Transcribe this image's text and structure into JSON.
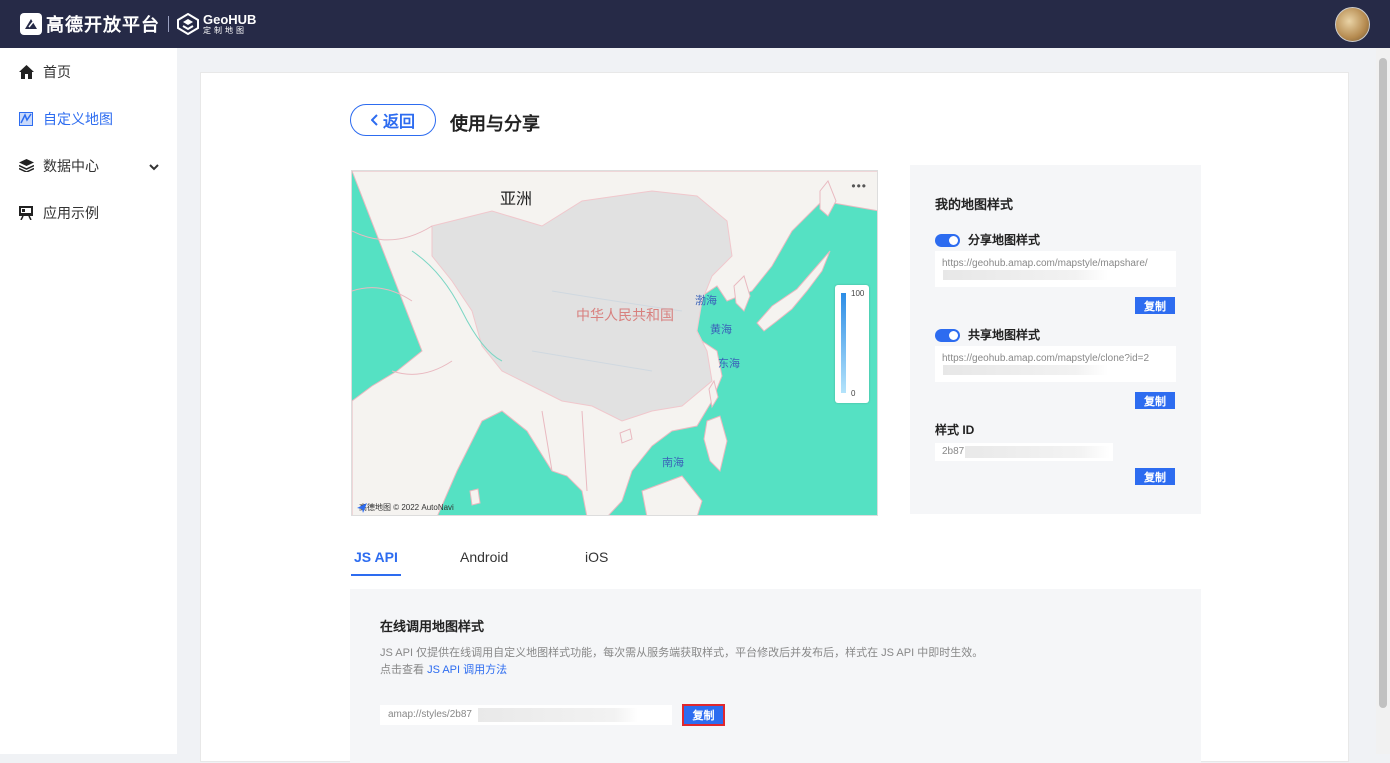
{
  "header": {
    "brand_name": "高德开放平台",
    "product_name": "GeoHUB",
    "product_sub": "定制地图"
  },
  "sidebar": {
    "items": [
      {
        "label": "首页",
        "icon": "home-icon"
      },
      {
        "label": "自定义地图",
        "icon": "map-icon"
      },
      {
        "label": "数据中心",
        "icon": "layers-icon"
      },
      {
        "label": "应用示例",
        "icon": "screen-icon"
      }
    ],
    "active_index": 1
  },
  "page": {
    "back_label": "返回",
    "title": "使用与分享"
  },
  "map": {
    "label_asia": "亚洲",
    "label_china": "中华人民共和国",
    "label_bohai": "渤海",
    "label_yellow_sea": "黄海",
    "label_east_sea": "东海",
    "label_south_sea": "南海",
    "legend_max": "100",
    "legend_min": "0",
    "attribution": "高德地图 © 2022 AutoNavi",
    "more": "•••",
    "colors": {
      "sea": "#55e1c3",
      "land": "#f5f3f0",
      "china": "#e1e1e1"
    }
  },
  "style_panel": {
    "title": "我的地图样式",
    "share": {
      "label": "分享地图样式",
      "url": "https://geohub.amap.com/mapstyle/mapshare/",
      "copy_label": "复制"
    },
    "clone": {
      "label": "共享地图样式",
      "url": "https://geohub.amap.com/mapstyle/clone?id=2",
      "copy_label": "复制"
    },
    "style_id": {
      "label": "样式 ID",
      "value": "2b87",
      "copy_label": "复制"
    }
  },
  "tabs": [
    {
      "label": "JS API"
    },
    {
      "label": "Android"
    },
    {
      "label": "iOS"
    }
  ],
  "api_panel": {
    "title": "在线调用地图样式",
    "description": "JS API 仅提供在线调用自定义地图样式功能，每次需从服务端获取样式，平台修改后并发布后，样式在 JS API 中即时生效。",
    "hint_prefix": "点击查看 ",
    "hint_link": "JS API 调用方法",
    "url_value": "amap://styles/2b87",
    "copy_label": "复制"
  },
  "colors": {
    "accent": "#2d6cf0",
    "topbar": "#262a47"
  }
}
